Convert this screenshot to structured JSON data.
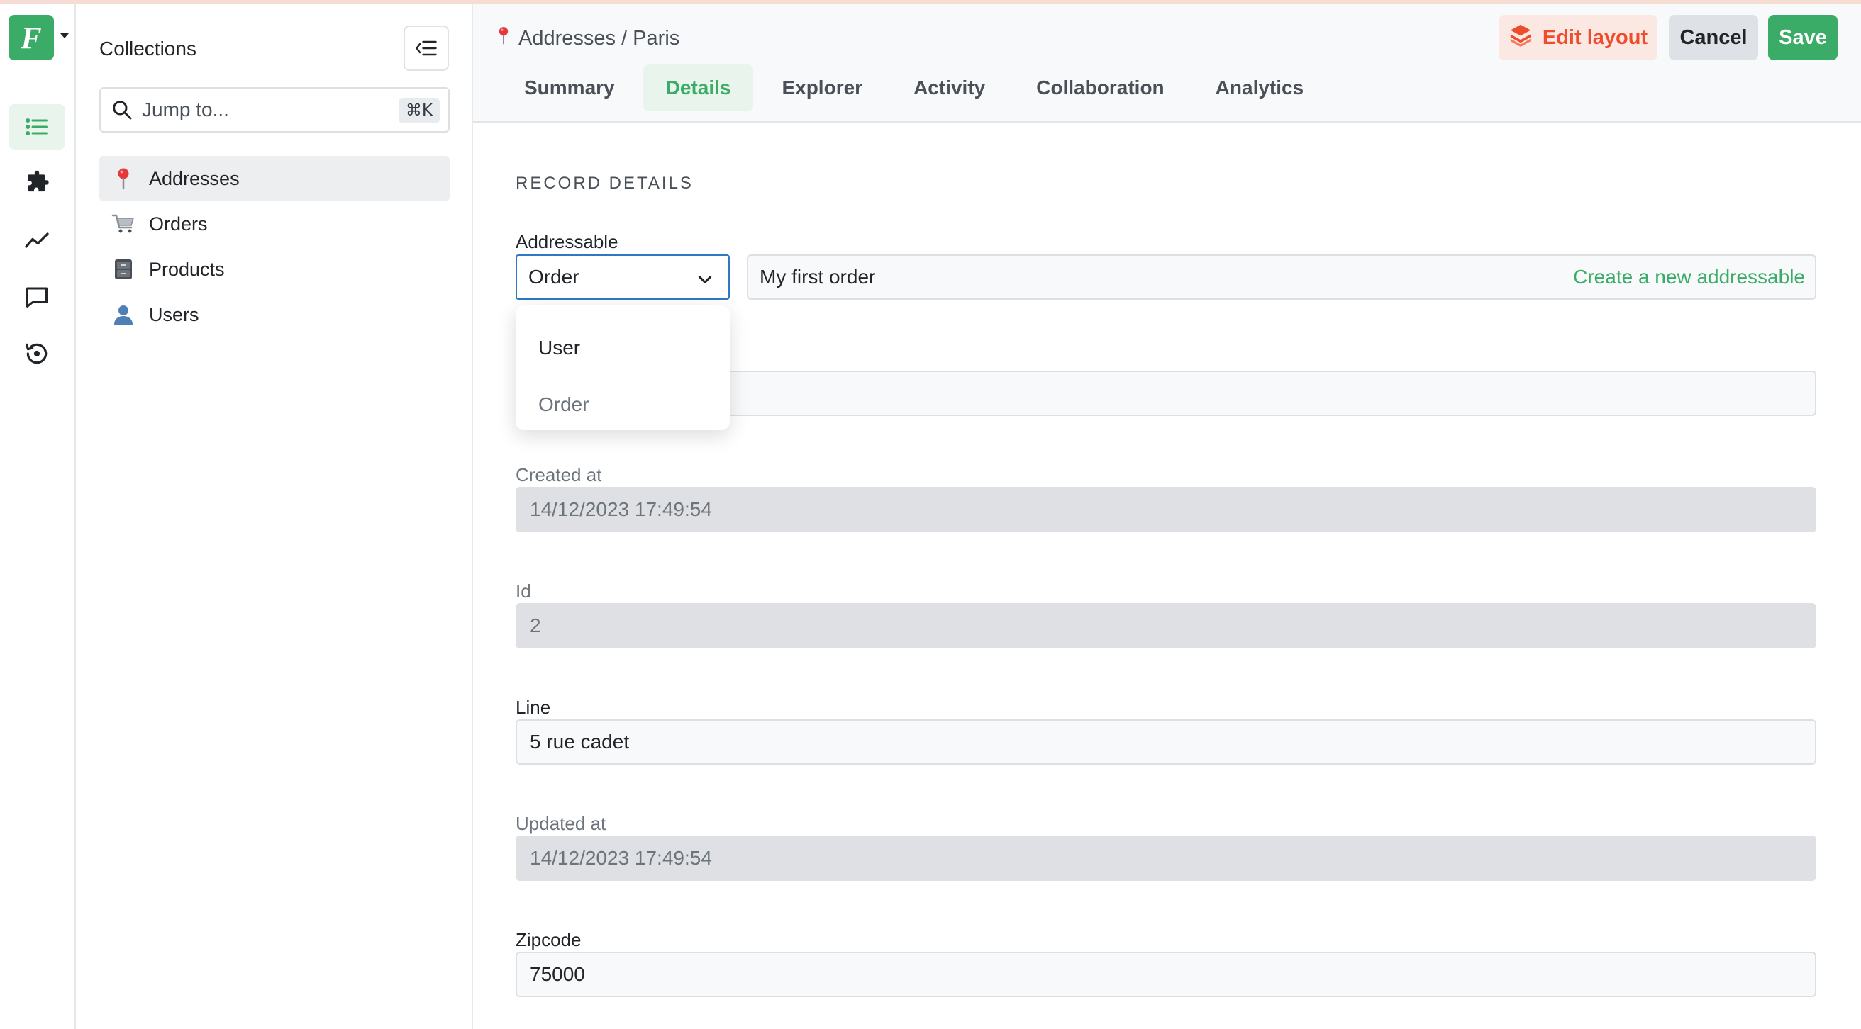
{
  "app": {
    "logo_letter": "F",
    "rail_icons": [
      "list-icon",
      "puzzle-icon",
      "chart-line-icon",
      "chat-icon",
      "history-icon"
    ],
    "accent_color": "#3aac67"
  },
  "sidebar": {
    "title": "Collections",
    "search": {
      "placeholder": "Jump to...",
      "shortcut": "⌘K"
    },
    "items": [
      {
        "label": "Addresses",
        "icon": "pin-icon",
        "active": true
      },
      {
        "label": "Orders",
        "icon": "cart-icon",
        "active": false
      },
      {
        "label": "Products",
        "icon": "cabinet-icon",
        "active": false
      },
      {
        "label": "Users",
        "icon": "user-icon",
        "active": false
      }
    ]
  },
  "header": {
    "breadcrumb": "Addresses / Paris",
    "tabs": [
      {
        "label": "Summary",
        "active": false
      },
      {
        "label": "Details",
        "active": true
      },
      {
        "label": "Explorer",
        "active": false
      },
      {
        "label": "Activity",
        "active": false
      },
      {
        "label": "Collaboration",
        "active": false
      },
      {
        "label": "Analytics",
        "active": false
      }
    ],
    "edit_layout_label": "Edit layout",
    "cancel_label": "Cancel",
    "save_label": "Save"
  },
  "record": {
    "section_title": "RECORD DETAILS",
    "addressable": {
      "label": "Addressable",
      "selected": "Order",
      "value": "My first order",
      "create_link": "Create a new addressable",
      "options": [
        "User",
        "Order"
      ]
    },
    "fields": [
      {
        "label": "Created at",
        "value": "14/12/2023 17:49:54",
        "readonly": true
      },
      {
        "label": "Id",
        "value": "2",
        "readonly": true
      },
      {
        "label": "Line",
        "value": "5 rue cadet",
        "readonly": false
      },
      {
        "label": "Updated at",
        "value": "14/12/2023 17:49:54",
        "readonly": true
      },
      {
        "label": "Zipcode",
        "value": "75000",
        "readonly": false
      }
    ]
  }
}
